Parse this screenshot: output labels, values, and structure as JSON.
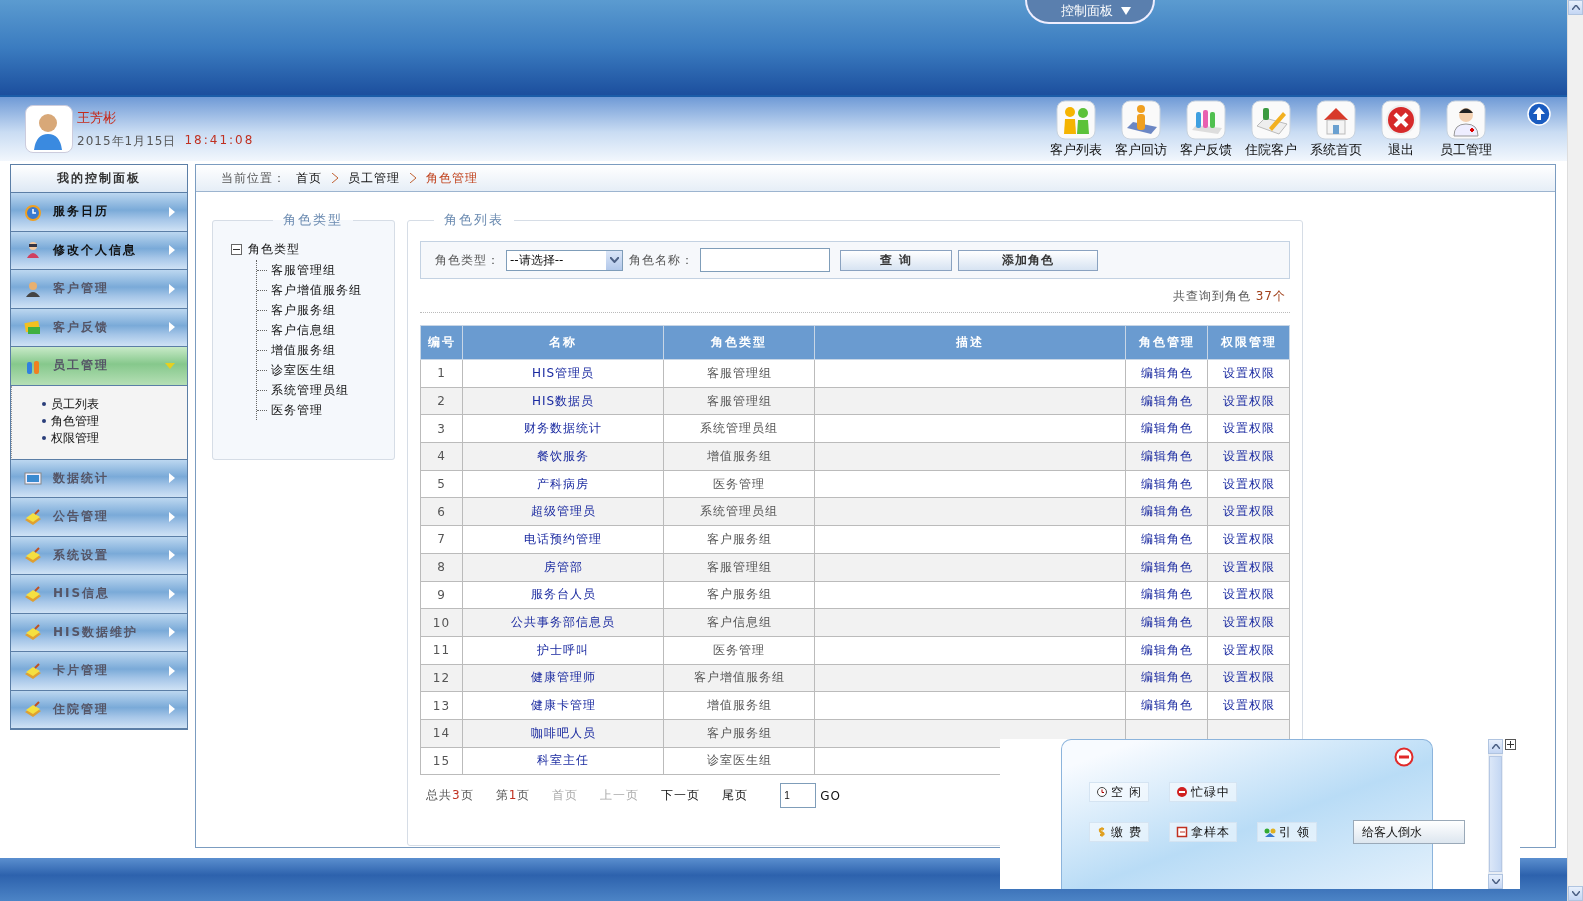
{
  "header": {
    "panel_tab": "控制面板",
    "user": {
      "name": "王芳彬",
      "date": "2015年1月15日",
      "time": "18:41:08"
    },
    "toolbar": [
      "客户列表",
      "客户回访",
      "客户反馈",
      "住院客户",
      "系统首页",
      "退出",
      "员工管理"
    ]
  },
  "sidebar": {
    "title": "我的控制面板",
    "items": [
      {
        "label": "服务日历",
        "expanded": false,
        "bold": true
      },
      {
        "label": "修改个人信息",
        "expanded": false,
        "bold": true
      },
      {
        "label": "客户管理",
        "expanded": false,
        "bold": false
      },
      {
        "label": "客户反馈",
        "expanded": false,
        "bold": false
      },
      {
        "label": "员工管理",
        "expanded": true,
        "bold": false,
        "children": [
          "员工列表",
          "角色管理",
          "权限管理"
        ]
      },
      {
        "label": "数据统计",
        "expanded": false,
        "bold": false
      },
      {
        "label": "公告管理",
        "expanded": false,
        "bold": false
      },
      {
        "label": "系统设置",
        "expanded": false,
        "bold": false
      },
      {
        "label": "HIS信息",
        "expanded": false,
        "bold": false
      },
      {
        "label": "HIS数据维护",
        "expanded": false,
        "bold": false
      },
      {
        "label": "卡片管理",
        "expanded": false,
        "bold": false
      },
      {
        "label": "住院管理",
        "expanded": false,
        "bold": false
      }
    ]
  },
  "breadcrumb": {
    "label": "当前位置：",
    "items": [
      "首页",
      "员工管理",
      "角色管理"
    ]
  },
  "tree_panel": {
    "title": "角色类型",
    "root": {
      "label": "角色类型",
      "expanded": true,
      "children": [
        "客服管理组",
        "客户增值服务组",
        "客户服务组",
        "客户信息组",
        "增值服务组",
        "诊室医生组",
        "系统管理员组",
        "医务管理"
      ]
    }
  },
  "list_panel": {
    "title": "角色列表",
    "filter": {
      "type_label": "角色类型：",
      "type_value": "--请选择--",
      "name_label": "角色名称：",
      "buttons": [
        "查 询",
        "添加角色"
      ]
    },
    "result": {
      "text": "共查询到角色",
      "count": "37个"
    },
    "table": {
      "columns": [
        "编号",
        "名称",
        "角色类型",
        "描述",
        "角色管理",
        "权限管理"
      ],
      "rows": [
        {
          "no": "1",
          "name": "HIS管理员",
          "type": "客服管理组",
          "edit": "编辑角色",
          "perm": "设置权限"
        },
        {
          "no": "2",
          "name": "HIS数据员",
          "type": "客服管理组",
          "edit": "编辑角色",
          "perm": "设置权限"
        },
        {
          "no": "3",
          "name": "财务数据统计",
          "type": "系统管理员组",
          "edit": "编辑角色",
          "perm": "设置权限"
        },
        {
          "no": "4",
          "name": "餐饮服务",
          "type": "增值服务组",
          "edit": "编辑角色",
          "perm": "设置权限"
        },
        {
          "no": "5",
          "name": "产科病房",
          "type": "医务管理",
          "edit": "编辑角色",
          "perm": "设置权限"
        },
        {
          "no": "6",
          "name": "超级管理员",
          "type": "系统管理员组",
          "edit": "编辑角色",
          "perm": "设置权限"
        },
        {
          "no": "7",
          "name": "电话预约管理",
          "type": "客户服务组",
          "edit": "编辑角色",
          "perm": "设置权限"
        },
        {
          "no": "8",
          "name": "房管部",
          "type": "客服管理组",
          "edit": "编辑角色",
          "perm": "设置权限"
        },
        {
          "no": "9",
          "name": "服务台人员",
          "type": "客户服务组",
          "edit": "编辑角色",
          "perm": "设置权限"
        },
        {
          "no": "10",
          "name": "公共事务部信息员",
          "type": "客户信息组",
          "edit": "编辑角色",
          "perm": "设置权限"
        },
        {
          "no": "11",
          "name": "护士呼叫",
          "type": "医务管理",
          "edit": "编辑角色",
          "perm": "设置权限"
        },
        {
          "no": "12",
          "name": "健康管理师",
          "type": "客户增值服务组",
          "edit": "编辑角色",
          "perm": "设置权限"
        },
        {
          "no": "13",
          "name": "健康卡管理",
          "type": "增值服务组",
          "edit": "编辑角色",
          "perm": "设置权限"
        },
        {
          "no": "14",
          "name": "咖啡吧人员",
          "type": "客户服务组"
        },
        {
          "no": "15",
          "name": "科室主任",
          "type": "诊室医生组"
        }
      ]
    },
    "pagination": {
      "total": {
        "before": "总共",
        "number": "3",
        "after": "页"
      },
      "current": {
        "before": "第",
        "number": "1",
        "after": "页"
      },
      "links": [
        {
          "label": "首页",
          "disabled": true
        },
        {
          "label": "上一页",
          "disabled": true
        },
        {
          "label": "下一页",
          "disabled": false
        },
        {
          "label": "尾页",
          "disabled": false
        }
      ],
      "page_value": "1",
      "go": "GO"
    }
  },
  "popup": {
    "buttons": [
      {
        "label": "空 闲",
        "kind": "icon"
      },
      {
        "label": "忙碌中",
        "kind": "icon"
      },
      {
        "label": "缴 费",
        "kind": "icon"
      },
      {
        "label": "拿样本",
        "kind": "icon"
      },
      {
        "label": "引 领",
        "kind": "icon"
      },
      {
        "label": "给客人倒水",
        "kind": "plain"
      }
    ]
  }
}
